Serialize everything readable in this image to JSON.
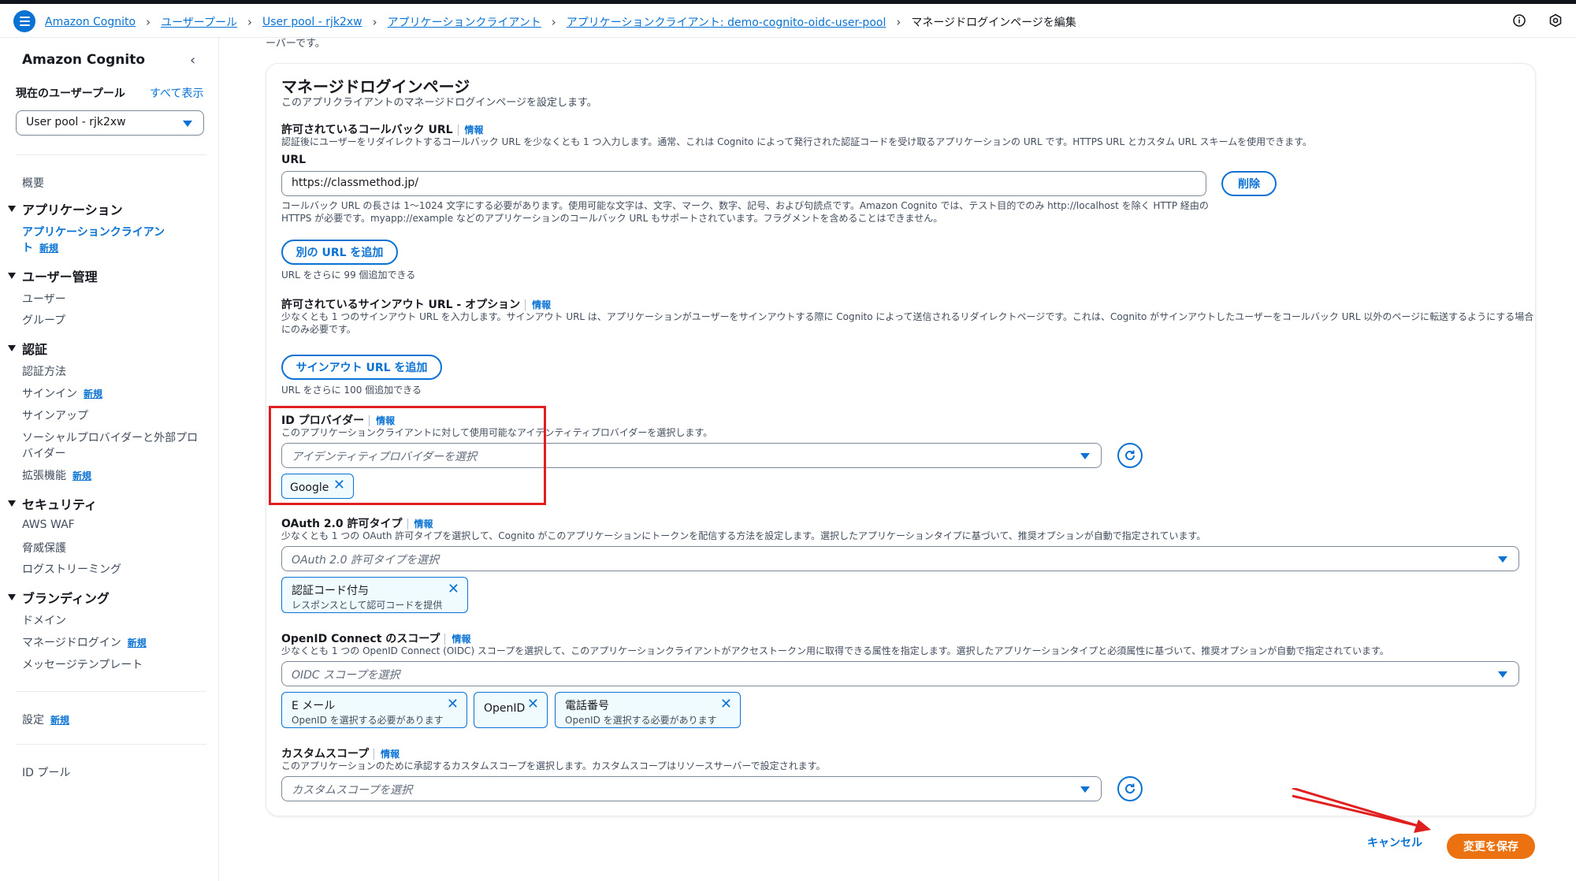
{
  "topbar": {
    "breadcrumbs": [
      "Amazon Cognito",
      "ユーザープール",
      "User pool - rjk2xw",
      "アプリケーションクライアント",
      "アプリケーションクライアント: demo-cognito-oidc-user-pool"
    ],
    "current": "マネージドログインページを編集"
  },
  "sidebar": {
    "title": "Amazon Cognito",
    "pool_label": "現在のユーザープール",
    "show_all": "すべて表示",
    "pool_select": "User pool - rjk2xw",
    "overview": "概要",
    "sections": {
      "applications": {
        "title": "アプリケーション",
        "items": [
          "アプリケーションクライアン",
          "ト"
        ],
        "new": "新規"
      },
      "user_mgmt": {
        "title": "ユーザー管理",
        "items": [
          "ユーザー",
          "グループ"
        ]
      },
      "auth": {
        "title": "認証",
        "items": [
          "認証方法",
          "サインイン",
          "サインアップ",
          "ソーシャルプロバイダーと外部プロ",
          "バイダー",
          "拡張機能"
        ],
        "new": "新規"
      },
      "security": {
        "title": "セキュリティ",
        "items": [
          "AWS WAF",
          "脅威保護",
          "ログストリーミング"
        ]
      },
      "branding": {
        "title": "ブランディング",
        "items": [
          "ドメイン",
          "マネージドログイン",
          "メッセージテンプレート"
        ],
        "new": "新規"
      }
    },
    "settings": "設定",
    "settings_new": "新規",
    "id_pool": "ID プール"
  },
  "main": {
    "top_cut_text": "ーバーです。",
    "card_title": "マネージドログインページ",
    "card_desc": "このアプリクライアントのマネージドログインページを設定します。",
    "info": "情報",
    "callback": {
      "label": "許可されているコールバック URL",
      "desc": "認証後にユーザーをリダイレクトするコールバック URL を少なくとも 1 つ入力します。通常、これは Cognito によって発行された認証コードを受け取るアプリケーションの URL です。HTTPS URL とカスタム URL スキームを使用できます。",
      "url_label": "URL",
      "url_value": "https://classmethod.jp/",
      "delete": "削除",
      "hint1": "コールバック URL の長さは 1～1024 文字にする必要があります。使用可能な文字は、文字、マーク、数字、記号、および句読点です。Amazon Cognito では、テスト目的でのみ http://localhost を除く HTTP 経由の",
      "hint2": "HTTPS が必要です。myapp://example などのアプリケーションのコールバック URL もサポートされています。フラグメントを含めることはできません。",
      "add": "別の URL を追加",
      "remaining": "URL をさらに 99 個追加できる"
    },
    "signout": {
      "label": "許可されているサインアウト URL - オプション",
      "desc1": "少なくとも 1 つのサインアウト URL を入力します。サインアウト URL は、アプリケーションがユーザーをサインアウトする際に Cognito によって送信されるリダイレクトページです。これは、Cognito がサインアウトしたユーザーをコールバック URL 以外のページに転送するようにする場合",
      "desc2": "にのみ必要です。",
      "add": "サインアウト URL を追加",
      "remaining": "URL をさらに 100 個追加できる"
    },
    "idp": {
      "label": "ID プロバイダー",
      "desc": "このアプリケーションクライアントに対して使用可能なアイデンティティプロバイダーを選択します。",
      "placeholder": "アイデンティティプロバイダーを選択",
      "tokens": [
        "Google"
      ]
    },
    "oauth": {
      "label": "OAuth 2.0 許可タイプ",
      "desc": "少なくとも 1 つの OAuth 許可タイプを選択して、Cognito がこのアプリケーションにトークンを配信する方法を設定します。選択したアプリケーションタイプに基づいて、推奨オプションが自動で指定されています。",
      "placeholder": "OAuth 2.0 許可タイプを選択",
      "token_title": "認証コード付与",
      "token_sub": "レスポンスとして認可コードを提供"
    },
    "oidc": {
      "label": "OpenID Connect のスコープ",
      "desc": "少なくとも 1 つの OpenID Connect (OIDC) スコープを選択して、このアプリケーションクライアントがアクセストークン用に取得できる属性を指定します。選択したアプリケーションタイプと必須属性に基づいて、推奨オプションが自動で指定されています。",
      "placeholder": "OIDC スコープを選択",
      "tokens": [
        {
          "title": "E メール",
          "sub": "OpenID を選択する必要があります"
        },
        {
          "title": "OpenID",
          "sub": ""
        },
        {
          "title": "電話番号",
          "sub": "OpenID を選択する必要があります"
        }
      ]
    },
    "custom": {
      "label": "カスタムスコープ",
      "desc": "このアプリケーションのために承認するカスタムスコープを選択します。カスタムスコープはリソースサーバーで設定されます。",
      "placeholder": "カスタムスコープを選択"
    },
    "cancel": "キャンセル",
    "save": "変更を保存"
  },
  "colors": {
    "accent": "#0972d3",
    "save": "#ec7211",
    "highlight": "#e02020",
    "arrow": "#e02020"
  }
}
